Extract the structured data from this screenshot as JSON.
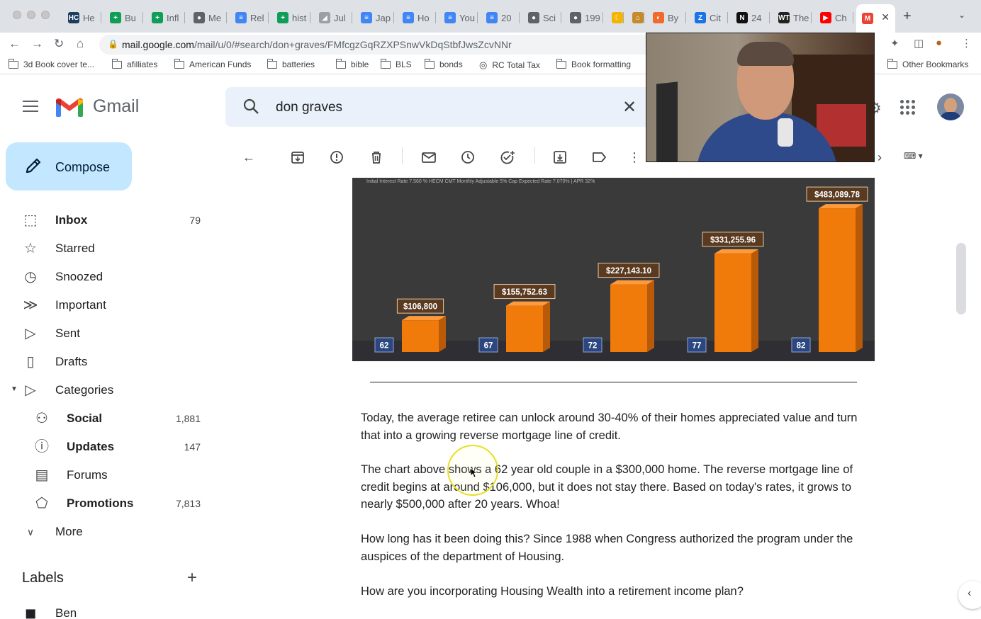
{
  "browser": {
    "tabs": [
      {
        "label": "He",
        "icon_text": "HC",
        "icon_color": "#1b3d5f"
      },
      {
        "label": "Bu",
        "icon_text": "+",
        "icon_color": "#0f9d58"
      },
      {
        "label": "Infl",
        "icon_text": "+",
        "icon_color": "#0f9d58"
      },
      {
        "label": "Me",
        "icon_text": "●",
        "icon_color": "#5f6368"
      },
      {
        "label": "Rel",
        "icon_text": "≡",
        "icon_color": "#4285f4"
      },
      {
        "label": "hist",
        "icon_text": "+",
        "icon_color": "#0f9d58"
      },
      {
        "label": "Jul",
        "icon_text": "◢",
        "icon_color": "#9aa0a6"
      },
      {
        "label": "Jap",
        "icon_text": "≡",
        "icon_color": "#4285f4"
      },
      {
        "label": "Ho",
        "icon_text": "≡",
        "icon_color": "#4285f4"
      },
      {
        "label": "You",
        "icon_text": "≡",
        "icon_color": "#4285f4"
      },
      {
        "label": "20",
        "icon_text": "≡",
        "icon_color": "#4285f4"
      },
      {
        "label": "Sci",
        "icon_text": "●",
        "icon_color": "#5f6368"
      },
      {
        "label": "199",
        "icon_text": "●",
        "icon_color": "#5f6368"
      },
      {
        "label": "",
        "icon_text": "☾",
        "icon_color": "#f4b400"
      },
      {
        "label": "",
        "icon_text": "⌂",
        "icon_color": "#c58a2a"
      },
      {
        "label": "By",
        "icon_text": "◐",
        "icon_color": "#f06a2a"
      },
      {
        "label": "Cit",
        "icon_text": "Z",
        "icon_color": "#1a73e8"
      },
      {
        "label": "24",
        "icon_text": "N",
        "icon_color": "#111111"
      },
      {
        "label": "The",
        "icon_text": "WT",
        "icon_color": "#222222"
      },
      {
        "label": "Ch",
        "icon_text": "▶",
        "icon_color": "#ff0000"
      },
      {
        "label": "",
        "icon_text": "M",
        "icon_color": "#ea4335"
      }
    ],
    "url_host": "mail.google.com",
    "url_path": "/mail/u/0/#search/don+graves/FMfcgzGqRZXPSnwVkDqStbfJwsZcvNNr",
    "bookmarks": [
      {
        "label": "3d Book cover te...",
        "icon": "folder"
      },
      {
        "label": "afilliates",
        "icon": "folder"
      },
      {
        "label": "American Funds",
        "icon": "folder"
      },
      {
        "label": "batteries",
        "icon": "folder"
      },
      {
        "label": "bible",
        "icon": "folder"
      },
      {
        "label": "BLS",
        "icon": "folder"
      },
      {
        "label": "bonds",
        "icon": "folder"
      },
      {
        "label": "RC Total Tax",
        "icon": "globe"
      },
      {
        "label": "Book formatting",
        "icon": "folder"
      }
    ],
    "other_bookmarks": "Other Bookmarks"
  },
  "gmail": {
    "brand": "Gmail",
    "search_query": "don graves",
    "compose_label": "Compose",
    "nav": [
      {
        "label": "Inbox",
        "count": "79",
        "bold": true,
        "icon": "inbox-icon"
      },
      {
        "label": "Starred",
        "count": "",
        "bold": false,
        "icon": "star-icon"
      },
      {
        "label": "Snoozed",
        "count": "",
        "bold": false,
        "icon": "clock-icon"
      },
      {
        "label": "Important",
        "count": "",
        "bold": false,
        "icon": "important-icon"
      },
      {
        "label": "Sent",
        "count": "",
        "bold": false,
        "icon": "send-icon"
      },
      {
        "label": "Drafts",
        "count": "",
        "bold": false,
        "icon": "draft-icon"
      },
      {
        "label": "Categories",
        "count": "",
        "bold": false,
        "icon": "label-icon"
      }
    ],
    "categories": [
      {
        "label": "Social",
        "count": "1,881",
        "icon": "people-icon"
      },
      {
        "label": "Updates",
        "count": "147",
        "icon": "info-icon"
      },
      {
        "label": "Forums",
        "count": "",
        "icon": "forum-icon"
      },
      {
        "label": "Promotions",
        "count": "7,813",
        "icon": "tag-icon"
      }
    ],
    "more_label": "More",
    "labels_heading": "Labels",
    "labels": [
      {
        "label": "Ben"
      }
    ]
  },
  "email": {
    "chart_caption": "Initial Interest Rate 7.560 % HECM  CMT Monthly Adjustable 5% Cap Expected Rate 7.070% | APR 32%",
    "paragraphs": [
      "Today, the average retiree can unlock around 30-40% of their homes appreciated value and turn that into a growing reverse mortgage line of credit.",
      "The chart above shows a 62 year old couple in a $300,000 home. The reverse mortgage line of credit begins at around $106,000, but it does not stay there. Based on today's rates, it grows to nearly $500,000 after 20 years. Whoa!",
      "How long has it been doing this? Since 1988 when Congress authorized the program under the auspices of the department of Housing.",
      "How are you incorporating Housing Wealth into a retirement income plan?"
    ]
  },
  "chart_data": {
    "type": "bar",
    "categories": [
      "62",
      "67",
      "72",
      "77",
      "82"
    ],
    "values": [
      106800,
      155752.63,
      227143.1,
      331255.96,
      483089.78
    ],
    "value_labels": [
      "$106,800",
      "$155,752.63",
      "$227,143.10",
      "$331,255.96",
      "$483,089.78"
    ],
    "title": "Initial Interest Rate 7.560 % HECM  CMT Monthly Adjustable 5% Cap Expected Rate 7.070% | APR 32%",
    "xlabel": "",
    "ylabel": "",
    "ylim": [
      0,
      500000
    ],
    "bar_color": "#f07a0a",
    "label_bg": "#5a3a20"
  }
}
